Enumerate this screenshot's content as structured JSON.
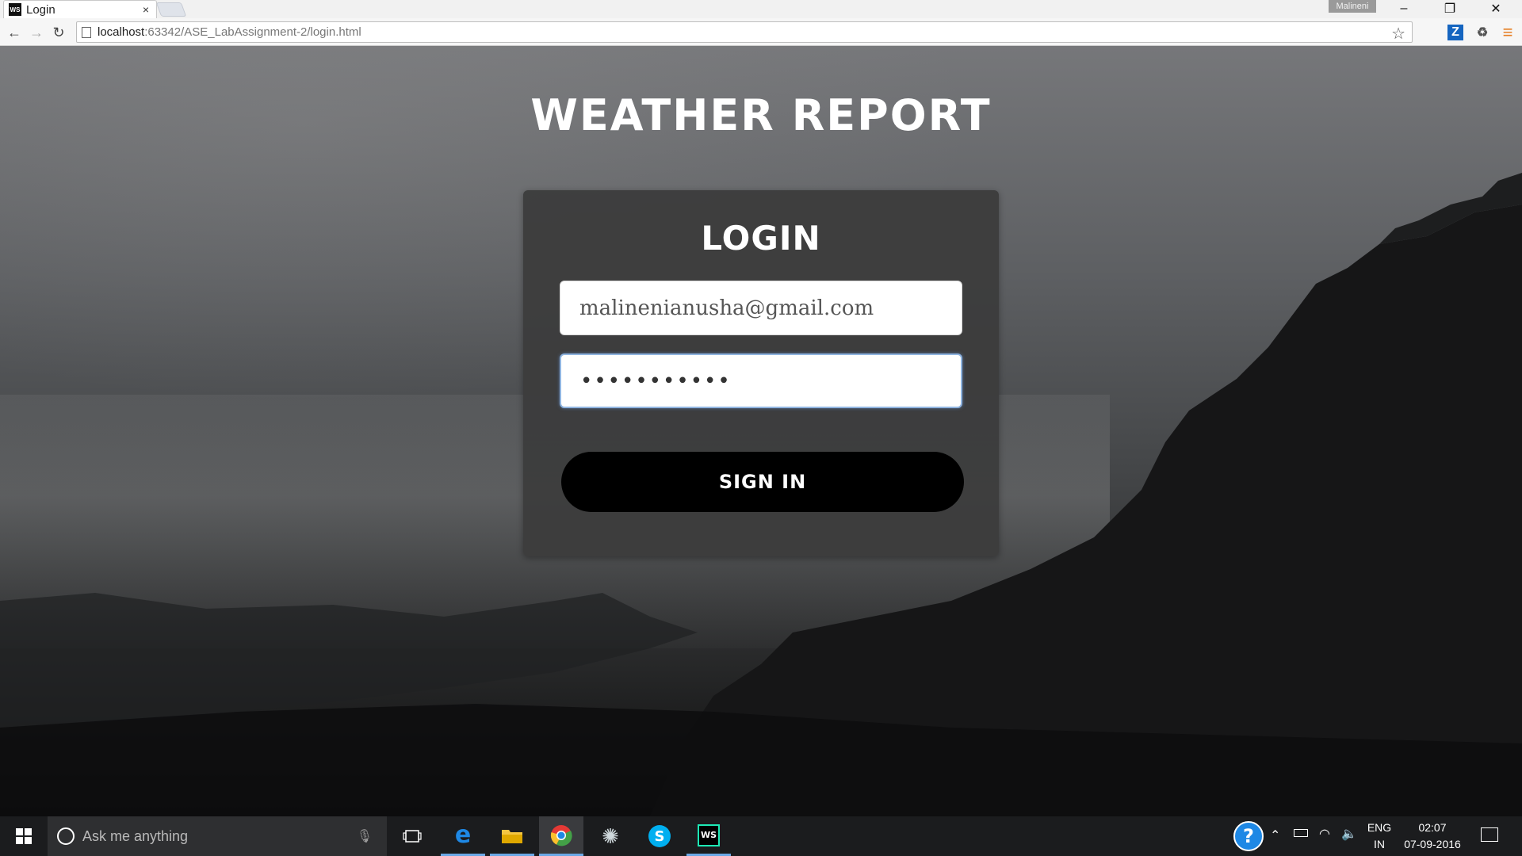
{
  "browser": {
    "tab_title": "Login",
    "tab_favicon_text": "WS",
    "tab_close": "×",
    "profile_name": "Malineni",
    "url_host": "localhost",
    "url_path": ":63342/ASE_LabAssignment-2/login.html",
    "window_controls": {
      "minimize": "–",
      "restore": "❐",
      "close": "✕"
    },
    "nav": {
      "back": "←",
      "forward": "→",
      "reload": "↻"
    },
    "bookmark_star": "☆",
    "extensions": [
      {
        "name": "z-extension-icon",
        "glyph": "Z",
        "color": "#1565c0"
      },
      {
        "name": "recycle-extension-icon",
        "glyph": "♻",
        "color": "#555555"
      },
      {
        "name": "menu-icon",
        "glyph": "≡",
        "color": "#e67e22"
      }
    ]
  },
  "page": {
    "heading": "WEATHER REPORT",
    "login": {
      "title": "LOGIN",
      "email_value": "malinenianusha@gmail.com",
      "password_value": "•••••••••••",
      "signin_label": "SIGN IN"
    }
  },
  "taskbar": {
    "search_placeholder": "Ask me anything",
    "apps": [
      {
        "name": "edge",
        "glyph": "e",
        "color": "#1e88e5",
        "running": true
      },
      {
        "name": "file-explorer",
        "glyph": "▬",
        "color": "#f4c542",
        "running": true
      },
      {
        "name": "chrome",
        "glyph": "◉",
        "color": "#e53935",
        "running": true,
        "active": true
      },
      {
        "name": "settings-app",
        "glyph": "✺",
        "color": "#cfd8dc",
        "running": false
      },
      {
        "name": "skype",
        "glyph": "S",
        "color": "#00aff0",
        "running": false
      },
      {
        "name": "webstorm",
        "glyph": "WS",
        "color": "#1de9b6",
        "running": true
      }
    ],
    "tray": {
      "help_glyph": "?",
      "language_line1": "ENG",
      "language_line2": "IN",
      "time": "02:07",
      "date": "07-09-2016"
    }
  }
}
